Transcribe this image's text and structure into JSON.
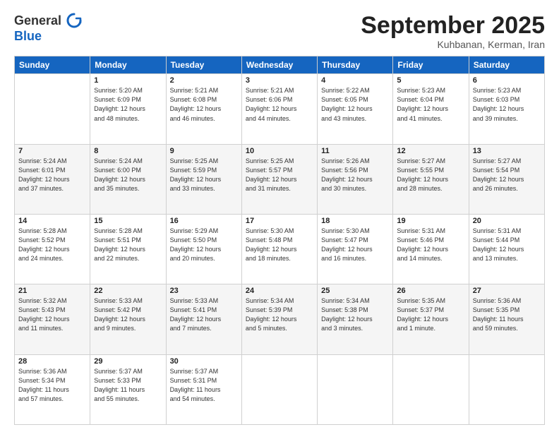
{
  "logo": {
    "line1": "General",
    "line2": "Blue"
  },
  "header": {
    "month": "September 2025",
    "location": "Kuhbanan, Kerman, Iran"
  },
  "weekdays": [
    "Sunday",
    "Monday",
    "Tuesday",
    "Wednesday",
    "Thursday",
    "Friday",
    "Saturday"
  ],
  "weeks": [
    [
      {
        "day": "",
        "info": ""
      },
      {
        "day": "1",
        "info": "Sunrise: 5:20 AM\nSunset: 6:09 PM\nDaylight: 12 hours\nand 48 minutes."
      },
      {
        "day": "2",
        "info": "Sunrise: 5:21 AM\nSunset: 6:08 PM\nDaylight: 12 hours\nand 46 minutes."
      },
      {
        "day": "3",
        "info": "Sunrise: 5:21 AM\nSunset: 6:06 PM\nDaylight: 12 hours\nand 44 minutes."
      },
      {
        "day": "4",
        "info": "Sunrise: 5:22 AM\nSunset: 6:05 PM\nDaylight: 12 hours\nand 43 minutes."
      },
      {
        "day": "5",
        "info": "Sunrise: 5:23 AM\nSunset: 6:04 PM\nDaylight: 12 hours\nand 41 minutes."
      },
      {
        "day": "6",
        "info": "Sunrise: 5:23 AM\nSunset: 6:03 PM\nDaylight: 12 hours\nand 39 minutes."
      }
    ],
    [
      {
        "day": "7",
        "info": "Sunrise: 5:24 AM\nSunset: 6:01 PM\nDaylight: 12 hours\nand 37 minutes."
      },
      {
        "day": "8",
        "info": "Sunrise: 5:24 AM\nSunset: 6:00 PM\nDaylight: 12 hours\nand 35 minutes."
      },
      {
        "day": "9",
        "info": "Sunrise: 5:25 AM\nSunset: 5:59 PM\nDaylight: 12 hours\nand 33 minutes."
      },
      {
        "day": "10",
        "info": "Sunrise: 5:25 AM\nSunset: 5:57 PM\nDaylight: 12 hours\nand 31 minutes."
      },
      {
        "day": "11",
        "info": "Sunrise: 5:26 AM\nSunset: 5:56 PM\nDaylight: 12 hours\nand 30 minutes."
      },
      {
        "day": "12",
        "info": "Sunrise: 5:27 AM\nSunset: 5:55 PM\nDaylight: 12 hours\nand 28 minutes."
      },
      {
        "day": "13",
        "info": "Sunrise: 5:27 AM\nSunset: 5:54 PM\nDaylight: 12 hours\nand 26 minutes."
      }
    ],
    [
      {
        "day": "14",
        "info": "Sunrise: 5:28 AM\nSunset: 5:52 PM\nDaylight: 12 hours\nand 24 minutes."
      },
      {
        "day": "15",
        "info": "Sunrise: 5:28 AM\nSunset: 5:51 PM\nDaylight: 12 hours\nand 22 minutes."
      },
      {
        "day": "16",
        "info": "Sunrise: 5:29 AM\nSunset: 5:50 PM\nDaylight: 12 hours\nand 20 minutes."
      },
      {
        "day": "17",
        "info": "Sunrise: 5:30 AM\nSunset: 5:48 PM\nDaylight: 12 hours\nand 18 minutes."
      },
      {
        "day": "18",
        "info": "Sunrise: 5:30 AM\nSunset: 5:47 PM\nDaylight: 12 hours\nand 16 minutes."
      },
      {
        "day": "19",
        "info": "Sunrise: 5:31 AM\nSunset: 5:46 PM\nDaylight: 12 hours\nand 14 minutes."
      },
      {
        "day": "20",
        "info": "Sunrise: 5:31 AM\nSunset: 5:44 PM\nDaylight: 12 hours\nand 13 minutes."
      }
    ],
    [
      {
        "day": "21",
        "info": "Sunrise: 5:32 AM\nSunset: 5:43 PM\nDaylight: 12 hours\nand 11 minutes."
      },
      {
        "day": "22",
        "info": "Sunrise: 5:33 AM\nSunset: 5:42 PM\nDaylight: 12 hours\nand 9 minutes."
      },
      {
        "day": "23",
        "info": "Sunrise: 5:33 AM\nSunset: 5:41 PM\nDaylight: 12 hours\nand 7 minutes."
      },
      {
        "day": "24",
        "info": "Sunrise: 5:34 AM\nSunset: 5:39 PM\nDaylight: 12 hours\nand 5 minutes."
      },
      {
        "day": "25",
        "info": "Sunrise: 5:34 AM\nSunset: 5:38 PM\nDaylight: 12 hours\nand 3 minutes."
      },
      {
        "day": "26",
        "info": "Sunrise: 5:35 AM\nSunset: 5:37 PM\nDaylight: 12 hours\nand 1 minute."
      },
      {
        "day": "27",
        "info": "Sunrise: 5:36 AM\nSunset: 5:35 PM\nDaylight: 11 hours\nand 59 minutes."
      }
    ],
    [
      {
        "day": "28",
        "info": "Sunrise: 5:36 AM\nSunset: 5:34 PM\nDaylight: 11 hours\nand 57 minutes."
      },
      {
        "day": "29",
        "info": "Sunrise: 5:37 AM\nSunset: 5:33 PM\nDaylight: 11 hours\nand 55 minutes."
      },
      {
        "day": "30",
        "info": "Sunrise: 5:37 AM\nSunset: 5:31 PM\nDaylight: 11 hours\nand 54 minutes."
      },
      {
        "day": "",
        "info": ""
      },
      {
        "day": "",
        "info": ""
      },
      {
        "day": "",
        "info": ""
      },
      {
        "day": "",
        "info": ""
      }
    ]
  ]
}
